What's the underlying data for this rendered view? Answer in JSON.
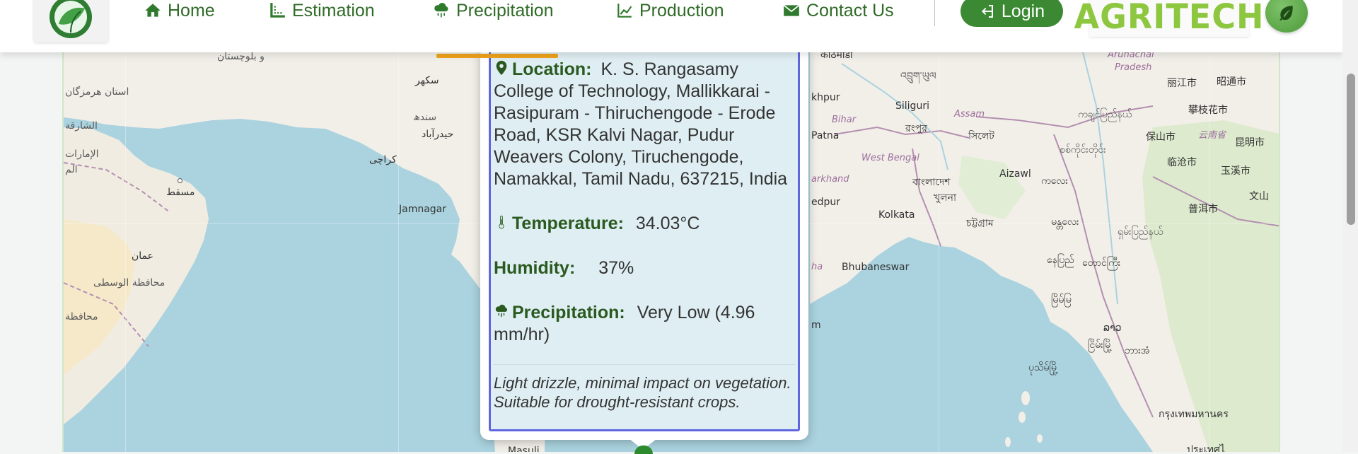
{
  "navbar": {
    "items": [
      {
        "label": "Home",
        "icon": "home-icon"
      },
      {
        "label": "Estimation",
        "icon": "ruler-icon"
      },
      {
        "label": "Precipitation",
        "icon": "cloud-rain-icon"
      },
      {
        "label": "Production",
        "icon": "chart-line-icon"
      },
      {
        "label": "Contact Us",
        "icon": "envelope-icon"
      }
    ],
    "login_label": "Login",
    "brand": "AGRITECH",
    "accent_color": "#3b8a33"
  },
  "popup": {
    "location_key": "Location:",
    "location_value": "K. S. Rangasamy College of Technology, Mallikkarai - Rasipuram - Thiruchengode - Erode Road, KSR Kalvi Nagar, Pudur Weavers Colony, Tiruchengode, Namakkal, Tamil Nadu, 637215, India",
    "temperature_key": "Temperature:",
    "temperature_value": "34.03°C",
    "humidity_key": "Humidity:",
    "humidity_value": "37%",
    "precipitation_key": "Precipitation:",
    "precipitation_value": "Very Low (4.96 mm/hr)",
    "note": "Light drizzle, minimal impact on vegetation. Suitable for drought-resistant crops."
  },
  "map": {
    "labels": {
      "hormozgan": "استان هرمزگان",
      "sharjah": "الشارقة",
      "emirates": "الإمارات",
      "emirates2": "الم",
      "muscat": "مسقط",
      "oman": "عمان",
      "wusta": "محافظة الوسطى",
      "dhofar": "محافظة",
      "baluchistan": "و بلوچستان",
      "sukkur": "سکھر",
      "sindh": "سندھ",
      "hyderabad": "حیدرآباد",
      "karachi": "کراچی",
      "jamnagar": "Jamnagar",
      "siliguri": "Siliguri",
      "kathmandu": "काठमाडौं",
      "bihar": "Bihar",
      "patna": "Patna",
      "khpur": "khpur",
      "assam": "Assam",
      "bengal": "West Bengal",
      "rangpur": "রংপুর",
      "sylhet": "সিলেট",
      "bhutan": "འབྲུག་ཡུལ",
      "bangladesh": "বাংলাদেশ",
      "khulna": "খুলনা",
      "kolkata": "Kolkata",
      "ctg": "চট্টগ্রাম",
      "arkhand": "arkhand",
      "edpur": "edpur",
      "aizawl": "Aizawl",
      "mizo": "ကလေး",
      "bhubaneswar": "Bhubaneswar",
      "odisha": "ha",
      "m": "m",
      "arunachal": "Arunachal",
      "pradesh": "Pradesh",
      "lijiang": "丽江市",
      "zhaotong": "昭通市",
      "panzhihua": "攀枝花市",
      "baoshan": "保山市",
      "yunnan": "云南省",
      "kunming": "昆明市",
      "lincang": "临沧市",
      "yuxi": "玉溪市",
      "puer": "普洱市",
      "wen": "文山",
      "kachin": "ကချင်ပြည်နယ်",
      "sagaing": "စစ်ကိုင်းတိုင်း",
      "mandalay": "မန္တလေး",
      "shan": "ရှမ်းပြည်နယ်",
      "taunggyi": "တောင်ကြီး",
      "magway": "မြိမ်မြ",
      "ayeyarwady": "ငြိမ်းမြို့",
      "naypyidaw": "နေပြည်",
      "bago": "ပုသိမ်မြို့",
      "yangon": "ဘားအံ",
      "krung": "กรุงเทพมหานคร",
      "thai": "ประเทศไ",
      "loei": "ລາວ",
      "masuli": "Masuli"
    }
  }
}
